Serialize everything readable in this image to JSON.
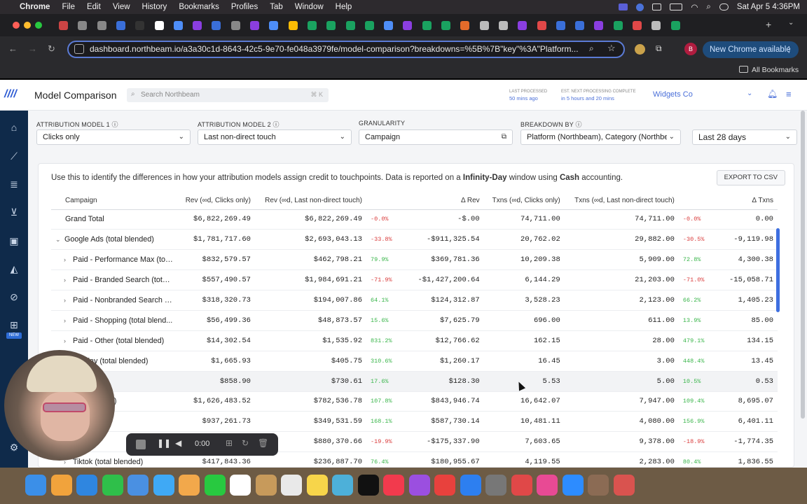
{
  "menubar": {
    "app": "Chrome",
    "items": [
      "File",
      "Edit",
      "View",
      "History",
      "Bookmarks",
      "Profiles",
      "Tab",
      "Window",
      "Help"
    ],
    "clock": "Sat Apr 5 4:36PM"
  },
  "browser": {
    "url": "dashboard.northbeam.io/a3a30c1d-8643-42c5-9e70-fe048a3979fe/model-comparison?breakdowns=%5B%7B\"key\"%3A\"Platform...",
    "new_chrome": "New Chrome available",
    "profile": "B",
    "all_bookmarks": "All Bookmarks"
  },
  "header": {
    "title": "Model Comparison",
    "search_placeholder": "Search Northbeam",
    "shortcut": "⌘ K",
    "last_processed_label": "LAST PROCESSED",
    "last_processed_value": "50 mins ago",
    "next_label": "EST. NEXT PROCESSING COMPLETE",
    "next_value": "in 5 hours and 20 mins",
    "workspace": "Widgets Co"
  },
  "sidebar": {
    "new_badge": "NEW"
  },
  "filters": {
    "model1_label": "ATTRIBUTION MODEL 1",
    "model1_value": "Clicks only",
    "model2_label": "ATTRIBUTION MODEL 2",
    "model2_value": "Last non-direct touch",
    "granularity_label": "GRANULARITY",
    "granularity_value": "Campaign",
    "breakdown_label": "BREAKDOWN BY",
    "breakdown_value": "Platform (Northbeam), Category (Northbe...",
    "date_range": "Last 28 days"
  },
  "card": {
    "info_pre": "Use this to identify the differences in how your attribution models assign credit to touchpoints. Data is reported on a ",
    "info_window": "Infinity-Day",
    "info_mid": " window using ",
    "info_cash": "Cash",
    "info_post": " accounting.",
    "export": "EXPORT TO CSV"
  },
  "table": {
    "headers": [
      "Campaign",
      "Rev (∞d, Clicks only)",
      "Rev (∞d, Last non-direct touch)",
      "",
      "Δ Rev",
      "Txns (∞d, Clicks only)",
      "Txns (∞d, Last non-direct touch)",
      "",
      "Δ Txns"
    ],
    "rows": [
      {
        "name": "Grand Total",
        "rev1": "$6,822,269.49",
        "rev2": "$6,822,269.49",
        "p1": "-0.0%",
        "d1": "-$.00",
        "t1": "74,711.00",
        "t2": "74,711.00",
        "p2": "-0.0%",
        "d2": "0.00"
      },
      {
        "name": "Google Ads (total blended)",
        "rev1": "$1,781,717.60",
        "rev2": "$2,693,043.13",
        "p1": "-33.8%",
        "d1": "-$911,325.54",
        "t1": "20,762.02",
        "t2": "29,882.00",
        "p2": "-30.5%",
        "d2": "-9,119.98"
      },
      {
        "name": "Paid - Performance Max (tot...",
        "rev1": "$832,579.57",
        "rev2": "$462,798.21",
        "p1": "79.9%",
        "d1": "$369,781.36",
        "t1": "10,209.38",
        "t2": "5,909.00",
        "p2": "72.8%",
        "d2": "4,300.38"
      },
      {
        "name": "Paid - Branded Search (total...",
        "rev1": "$557,490.57",
        "rev2": "$1,984,691.21",
        "p1": "-71.9%",
        "d1": "-$1,427,200.64",
        "t1": "6,144.29",
        "t2": "21,203.00",
        "p2": "-71.0%",
        "d2": "-15,058.71"
      },
      {
        "name": "Paid - Nonbranded Search (...",
        "rev1": "$318,320.73",
        "rev2": "$194,007.86",
        "p1": "64.1%",
        "d1": "$124,312.87",
        "t1": "3,528.23",
        "t2": "2,123.00",
        "p2": "66.2%",
        "d2": "1,405.23"
      },
      {
        "name": "Paid - Shopping (total blend...",
        "rev1": "$56,499.36",
        "rev2": "$48,873.57",
        "p1": "15.6%",
        "d1": "$7,625.79",
        "t1": "696.00",
        "t2": "611.00",
        "p2": "13.9%",
        "d2": "85.00"
      },
      {
        "name": "Paid - Other (total blended)",
        "rev1": "$14,302.54",
        "rev2": "$1,535.92",
        "p1": "831.2%",
        "d1": "$12,766.62",
        "t1": "162.15",
        "t2": "28.00",
        "p2": "479.1%",
        "d2": "134.15"
      },
      {
        "name": "Display (total blended)",
        "rev1": "$1,665.93",
        "rev2": "$405.75",
        "p1": "310.6%",
        "d1": "$1,260.17",
        "t1": "16.45",
        "t2": "3.00",
        "p2": "448.4%",
        "d2": "13.45"
      },
      {
        "name": "blended)",
        "rev1": "$858.90",
        "rev2": "$730.61",
        "p1": "17.6%",
        "d1": "$128.30",
        "t1": "5.53",
        "t2": "5.00",
        "p2": "10.5%",
        "d2": "0.53"
      },
      {
        "name": "otal blended)",
        "rev1": "$1,626,483.52",
        "rev2": "$782,536.78",
        "p1": "107.8%",
        "d1": "$843,946.74",
        "t1": "16,642.07",
        "t2": "7,947.00",
        "p2": "109.4%",
        "d2": "8,695.07"
      },
      {
        "name": "lended)",
        "rev1": "$937,261.73",
        "rev2": "$349,531.59",
        "p1": "168.1%",
        "d1": "$587,730.14",
        "t1": "10,481.11",
        "t2": "4,080.00",
        "p2": "156.9%",
        "d2": "6,401.11"
      },
      {
        "name": "blended",
        "rev1": "",
        "rev2": "$880,370.66",
        "p1": "-19.9%",
        "d1": "-$175,337.90",
        "t1": "7,603.65",
        "t2": "9,378.00",
        "p2": "-18.9%",
        "d2": "-1,774.35"
      },
      {
        "name": "Tiktok (total blended)",
        "rev1": "$417,843.36",
        "rev2": "$236,887.70",
        "p1": "76.4%",
        "d1": "$180,955.67",
        "t1": "4,119.55",
        "t2": "2,283.00",
        "p2": "80.4%",
        "d2": "1,836.55"
      }
    ]
  },
  "recorder": {
    "time": "0:00"
  },
  "colors": {
    "accent": "#5b7bd5",
    "sidebar": "#0f2a4a",
    "negative": "#d93a3a",
    "positive": "#39b54a"
  }
}
